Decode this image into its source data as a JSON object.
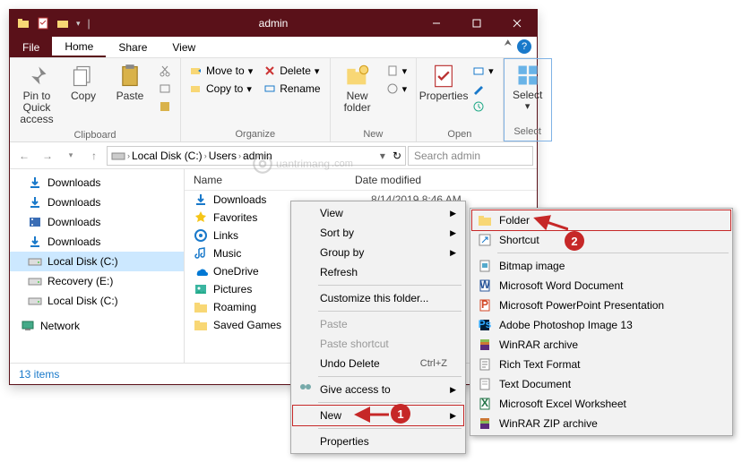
{
  "window": {
    "title": "admin"
  },
  "tabs": {
    "file": "File",
    "home": "Home",
    "share": "Share",
    "view": "View"
  },
  "ribbon": {
    "clipboard": {
      "label": "Clipboard",
      "pin": "Pin to Quick access",
      "copy": "Copy",
      "paste": "Paste"
    },
    "organize": {
      "label": "Organize",
      "move": "Move to",
      "copyto": "Copy to",
      "delete": "Delete",
      "rename": "Rename"
    },
    "new": {
      "label": "New",
      "folder": "New folder"
    },
    "open": {
      "label": "Open",
      "properties": "Properties"
    },
    "select": {
      "label": "Select",
      "btn": "Select"
    }
  },
  "address": {
    "crumbs": [
      "Local Disk (C:)",
      "Users",
      "admin"
    ],
    "search_placeholder": "Search admin"
  },
  "sidebar": [
    {
      "icon": "download",
      "label": "Downloads"
    },
    {
      "icon": "download",
      "label": "Downloads"
    },
    {
      "icon": "video",
      "label": "Downloads"
    },
    {
      "icon": "download",
      "label": "Downloads"
    },
    {
      "icon": "disk",
      "label": "Local Disk (C:)",
      "selected": true
    },
    {
      "icon": "disk",
      "label": "Recovery (E:)"
    },
    {
      "icon": "disk",
      "label": "Local Disk (C:)"
    }
  ],
  "network_label": "Network",
  "columns": {
    "name": "Name",
    "date": "Date modified"
  },
  "files": [
    {
      "icon": "download",
      "name": "Downloads",
      "date": "8/14/2019 8:46 AM"
    },
    {
      "icon": "star",
      "name": "Favorites",
      "date": ""
    },
    {
      "icon": "link",
      "name": "Links",
      "date": ""
    },
    {
      "icon": "music",
      "name": "Music",
      "date": ""
    },
    {
      "icon": "onedrive",
      "name": "OneDrive",
      "date": ""
    },
    {
      "icon": "pictures",
      "name": "Pictures",
      "date": ""
    },
    {
      "icon": "folder",
      "name": "Roaming",
      "date": ""
    },
    {
      "icon": "folder",
      "name": "Saved Games",
      "date": ""
    }
  ],
  "status": "13 items",
  "ctx1": {
    "view": "View",
    "sort": "Sort by",
    "group": "Group by",
    "refresh": "Refresh",
    "customize": "Customize this folder...",
    "paste": "Paste",
    "paste_shortcut": "Paste shortcut",
    "undo": "Undo Delete",
    "undo_key": "Ctrl+Z",
    "give_access": "Give access to",
    "new": "New",
    "properties": "Properties"
  },
  "ctx2": [
    {
      "icon": "folder",
      "label": "Folder",
      "hl": true
    },
    {
      "icon": "shortcut",
      "label": "Shortcut"
    },
    {
      "sep": true
    },
    {
      "icon": "bmp",
      "label": "Bitmap image"
    },
    {
      "icon": "word",
      "label": "Microsoft Word Document"
    },
    {
      "icon": "ppt",
      "label": "Microsoft PowerPoint Presentation"
    },
    {
      "icon": "psd",
      "label": "Adobe Photoshop Image 13"
    },
    {
      "icon": "rar",
      "label": "WinRAR archive"
    },
    {
      "icon": "rtf",
      "label": "Rich Text Format"
    },
    {
      "icon": "txt",
      "label": "Text Document"
    },
    {
      "icon": "xls",
      "label": "Microsoft Excel Worksheet"
    },
    {
      "icon": "zip",
      "label": "WinRAR ZIP archive"
    }
  ],
  "callouts": {
    "1": "1",
    "2": "2"
  },
  "watermark": "uantrimang"
}
